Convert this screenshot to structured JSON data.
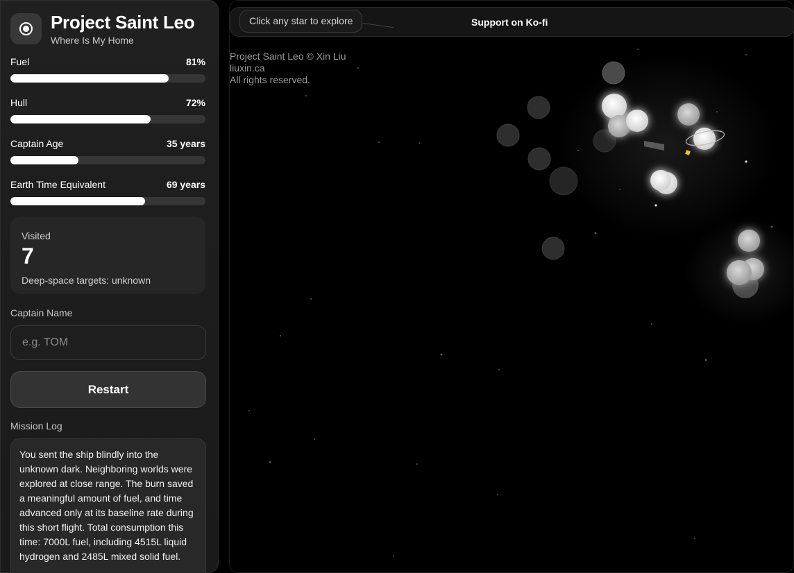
{
  "app": {
    "title": "Project Saint Leo",
    "subtitle": "Where Is My Home",
    "logo_icon": "orbit-target-icon"
  },
  "stats": [
    {
      "label": "Fuel",
      "value": "81%",
      "progress": 0.81
    },
    {
      "label": "Hull",
      "value": "72%",
      "progress": 0.72
    },
    {
      "label": "Captain Age",
      "value": "35 years",
      "progress": 0.35
    },
    {
      "label": "Earth Time Equivalent",
      "value": "69 years",
      "progress": 0.69
    }
  ],
  "visited": {
    "label": "Visited",
    "count": "7",
    "note": "Deep-space targets: unknown"
  },
  "captain": {
    "label": "Captain Name",
    "placeholder": "e.g. TOM",
    "value": ""
  },
  "restart_label": "Restart",
  "mission_log": {
    "label": "Mission Log",
    "text": "You sent the ship blindly into the unknown dark. Neighboring worlds were explored at close range. The burn saved a meaningful amount of fuel, and time advanced only at its baseline rate during this short flight. Total consumption this time: 7000L fuel, including 4515L liquid hydrogen and 2485L mixed solid fuel."
  },
  "space": {
    "hint": "Click any star to explore",
    "kofi_label": "Support on Ko-fi",
    "credits": [
      "Project Saint Leo © Xin Liu",
      "liuxin.ca",
      "All rights reserved."
    ]
  },
  "colors": {
    "background": "#000000",
    "panel": "#1f1f1f",
    "bar_fill": "#ffffff",
    "bar_track": "#363636",
    "ship": "#f5c518"
  }
}
